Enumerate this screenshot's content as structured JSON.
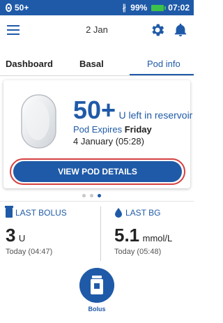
{
  "status_bar": {
    "left": "50+",
    "battery": "99%",
    "time": "07:02"
  },
  "header": {
    "date": "2 Jan"
  },
  "tabs": [
    {
      "label": "Dashboard"
    },
    {
      "label": "Basal"
    },
    {
      "label": "Pod info"
    }
  ],
  "active_tab": "Pod info",
  "pod_card": {
    "reservoir_value": "50+",
    "reservoir_text": "U left in reservoir",
    "expires_label": "Pod Expires",
    "expires_day": "Friday",
    "expires_date": "4 January (05:28)",
    "button_label": "VIEW POD DETAILS"
  },
  "pager": {
    "count": 3,
    "active_index": 2
  },
  "last_bolus": {
    "title": "LAST BOLUS",
    "value": "3",
    "unit": "U",
    "time": "Today (04:47)"
  },
  "last_bg": {
    "title": "LAST BG",
    "value": "5.1",
    "unit": "mmol/L",
    "time": "Today (05:48)"
  },
  "bolus_button": {
    "label": "Bolus"
  },
  "colors": {
    "brand_blue": "#1f5aa8",
    "highlight_red": "#d64040",
    "battery_green": "#3cc24a"
  },
  "icons": [
    "lock-icon",
    "bluetooth-icon",
    "battery-icon",
    "menu-icon",
    "gear-icon",
    "bell-icon",
    "pod-image",
    "vial-icon",
    "drop-icon"
  ]
}
